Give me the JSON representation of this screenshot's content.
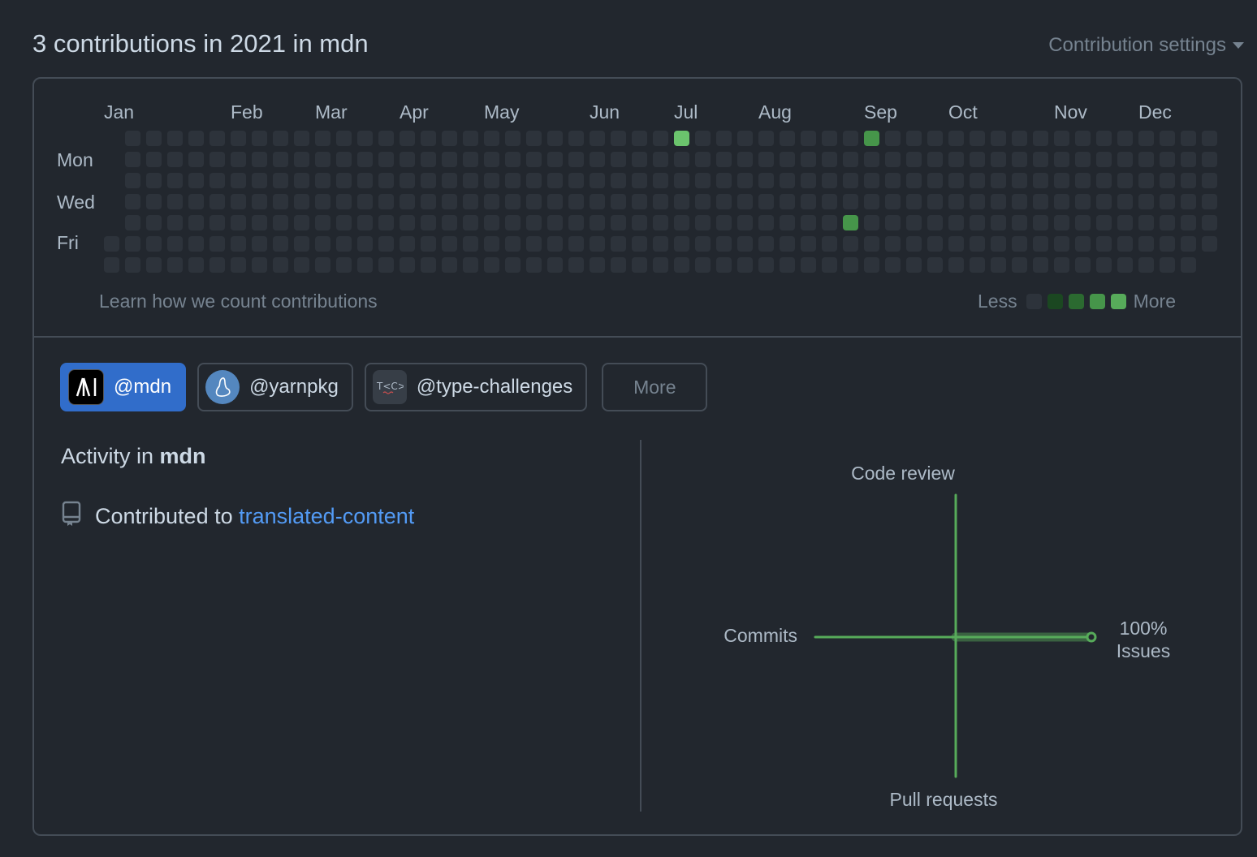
{
  "header": {
    "title": "3 contributions in 2021 in mdn",
    "settings_label": "Contribution settings"
  },
  "calendar": {
    "months": [
      "Jan",
      "Feb",
      "Mar",
      "Apr",
      "May",
      "Jun",
      "Jul",
      "Aug",
      "Sep",
      "Oct",
      "Nov",
      "Dec"
    ],
    "day_labels": [
      "Mon",
      "Wed",
      "Fri"
    ],
    "contributions": [
      {
        "week": 26,
        "weekday": 0,
        "level": 4
      },
      {
        "week": 35,
        "weekday": 0,
        "level": 3
      },
      {
        "week": 34,
        "weekday": 4,
        "level": 3
      }
    ],
    "learn_label": "Learn how we count contributions",
    "legend_less": "Less",
    "legend_more": "More",
    "colors": [
      "#2d333b",
      "#1b4721",
      "#2b6a30",
      "#46954a",
      "#6bc46d"
    ]
  },
  "orgs": [
    {
      "label": "@mdn",
      "selected": true,
      "avatar_icon": "mdn-logo-icon"
    },
    {
      "label": "@yarnpkg",
      "selected": false,
      "avatar_icon": "yarn-logo-icon"
    },
    {
      "label": "@type-challenges",
      "selected": false,
      "avatar_icon": "type-challenges-logo-icon"
    }
  ],
  "more_label": "More",
  "activity": {
    "title_prefix": "Activity in",
    "title_org": "mdn",
    "item_prefix": "Contributed to",
    "item_link": "translated-content"
  },
  "chart_data": {
    "type": "radial-axes",
    "axes": [
      "Code review",
      "Issues",
      "Pull requests",
      "Commits"
    ],
    "values": {
      "Code review": 0,
      "Issues": 100,
      "Pull requests": 0,
      "Commits": 0
    },
    "labels": {
      "top": "Code review",
      "right_pct": "100%",
      "right": "Issues",
      "bottom": "Pull requests",
      "left": "Commits"
    },
    "color": "#57ab5a"
  }
}
